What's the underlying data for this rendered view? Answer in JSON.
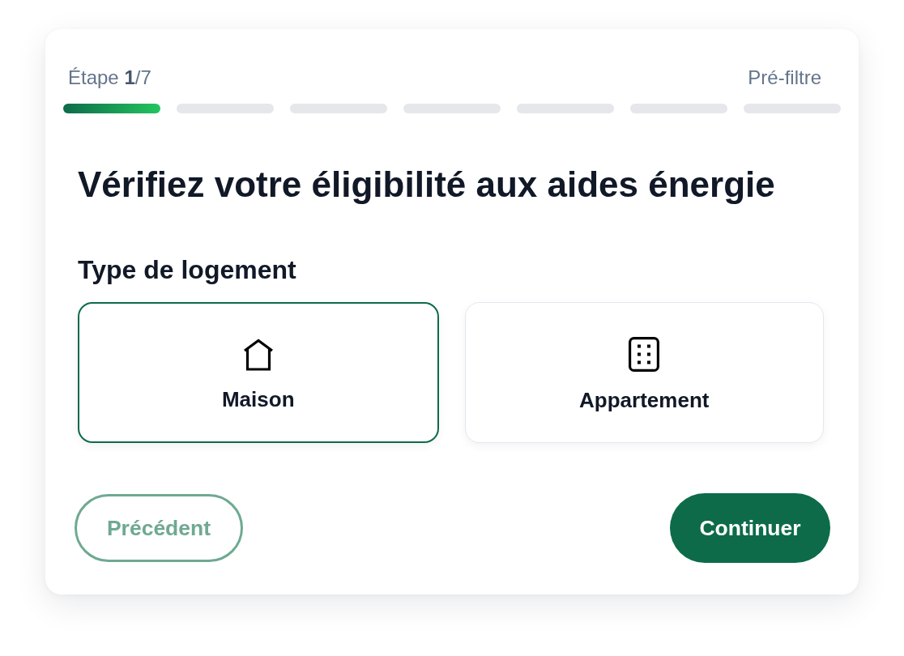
{
  "progress": {
    "step_label": "Étape **1**/7",
    "stage": "Pré-filtre",
    "segments": [
      {
        "done": true
      },
      {
        "done": false
      },
      {
        "done": false
      },
      {
        "done": false
      },
      {
        "done": false
      },
      {
        "done": false
      },
      {
        "done": false
      }
    ]
  },
  "title": "Vérifiez votre éligibilité aux aides énergie",
  "housing": {
    "label": "Type de logement",
    "options": [
      {
        "label": "Maison",
        "selected": true
      },
      {
        "label": "Appartement",
        "selected": false
      }
    ]
  },
  "actions": [
    {
      "kind": "secondary",
      "label": "Précédent",
      "disabled": true
    },
    {
      "kind": "primary",
      "label": "Continuer",
      "disabled": false
    }
  ]
}
